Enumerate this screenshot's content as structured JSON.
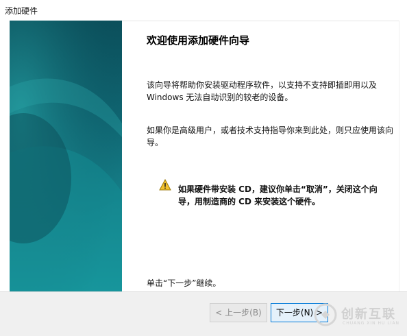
{
  "window": {
    "title": "添加硬件"
  },
  "content": {
    "heading": "欢迎使用添加硬件向导",
    "para1": "该向导将帮助你安装驱动程序软件，以支持不支持即插即用以及 Windows 无法自动识别的较老的设备。",
    "para2": "如果你是高级用户，或者技术支持指导你来到此处，则只应使用该向导。",
    "warning": "如果硬件带安装 CD，建议你单击“取消”，关闭这个向导，用制造商的 CD 来安装这个硬件。",
    "continue_hint": "单击“下一步”继续。"
  },
  "footer": {
    "back_label": "< 上一步(B)",
    "next_label": "下一步(N) >"
  },
  "watermark": {
    "main": "创新互联",
    "sub": "CHUANG XIN HU LIAN"
  },
  "colors": {
    "side_top": "#0b4f5b",
    "side_bottom": "#1a9aa0",
    "warning_yellow": "#f2c12e",
    "accent_blue": "#0078d7"
  }
}
